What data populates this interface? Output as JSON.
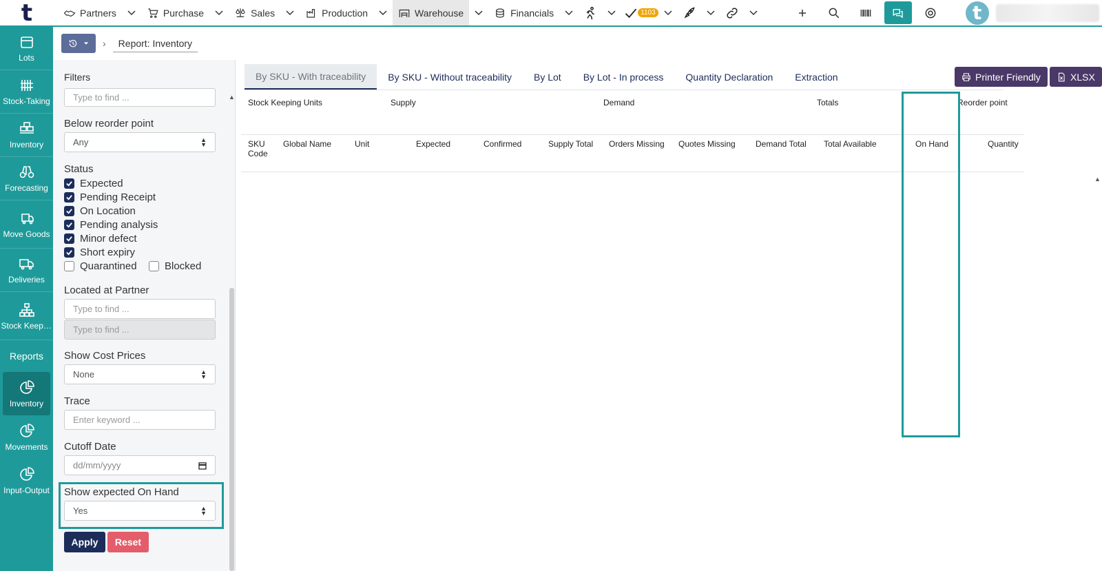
{
  "topbar": {
    "logo": "t",
    "nav": [
      {
        "label": "Partners",
        "icon": "handshake-icon"
      },
      {
        "label": "Purchase",
        "icon": "cart-icon"
      },
      {
        "label": "Sales",
        "icon": "scale-icon"
      },
      {
        "label": "Production",
        "icon": "factory-icon"
      },
      {
        "label": "Warehouse",
        "icon": "warehouse-icon"
      },
      {
        "label": "Financials",
        "icon": "coins-icon"
      }
    ],
    "task_badge": "1103",
    "avatar_letter": "t"
  },
  "sidebar": {
    "items": [
      {
        "label": "Lots"
      },
      {
        "label": "Stock-Taking"
      },
      {
        "label": "Inventory"
      },
      {
        "label": "Forecasting"
      },
      {
        "label": "Move Goods"
      },
      {
        "label": "Deliveries"
      },
      {
        "label": "Stock Keeping Units"
      }
    ],
    "section": "Reports",
    "reports": [
      {
        "label": "Inventory"
      },
      {
        "label": "Movements"
      },
      {
        "label": "Input-Output"
      }
    ]
  },
  "breadcrumb": {
    "current": "Report: Inventory"
  },
  "filters": {
    "title": "Filters",
    "top_input_placeholder": "Type to find ...",
    "below_reorder": {
      "label": "Below reorder point",
      "value": "Any"
    },
    "status": {
      "label": "Status",
      "options": [
        {
          "label": "Expected",
          "checked": true
        },
        {
          "label": "Pending Receipt",
          "checked": true
        },
        {
          "label": "On Location",
          "checked": true
        },
        {
          "label": "Pending analysis",
          "checked": true
        },
        {
          "label": "Minor defect",
          "checked": true
        },
        {
          "label": "Short expiry",
          "checked": true
        },
        {
          "label": "Quarantined",
          "checked": false
        },
        {
          "label": "Blocked",
          "checked": false
        }
      ]
    },
    "located_at_partner": {
      "label": "Located at Partner",
      "placeholder1": "Type to find ...",
      "placeholder2": "Type to find ..."
    },
    "show_cost_prices": {
      "label": "Show Cost Prices",
      "value": "None"
    },
    "trace": {
      "label": "Trace",
      "placeholder": "Enter keyword ..."
    },
    "cutoff_date": {
      "label": "Cutoff Date",
      "placeholder": "dd/mm/yyyy"
    },
    "show_expected_on_hand": {
      "label": "Show expected On Hand",
      "value": "Yes"
    },
    "apply_label": "Apply",
    "reset_label": "Reset"
  },
  "tabs": [
    "By SKU - With traceability",
    "By SKU - Without traceability",
    "By Lot",
    "By Lot - In process",
    "Quantity Declaration",
    "Extraction"
  ],
  "actions": {
    "printer_friendly": "Printer Friendly",
    "xlsx": "XLSX"
  },
  "table": {
    "groups": [
      "Stock Keeping Units",
      "Supply",
      "Demand",
      "Totals",
      "Reorder point"
    ],
    "columns": [
      "SKU Code",
      "Global Name",
      "Unit",
      "Expected",
      "Confirmed",
      "Supply Total",
      "Orders Missing",
      "Quotes Missing",
      "Demand Total",
      "Total Available",
      "On Hand",
      "Quantity"
    ]
  },
  "colors": {
    "accent": "#1f9a9a",
    "primary": "#1c2d5a",
    "danger": "#e35d6a",
    "action": "#4a3868"
  }
}
